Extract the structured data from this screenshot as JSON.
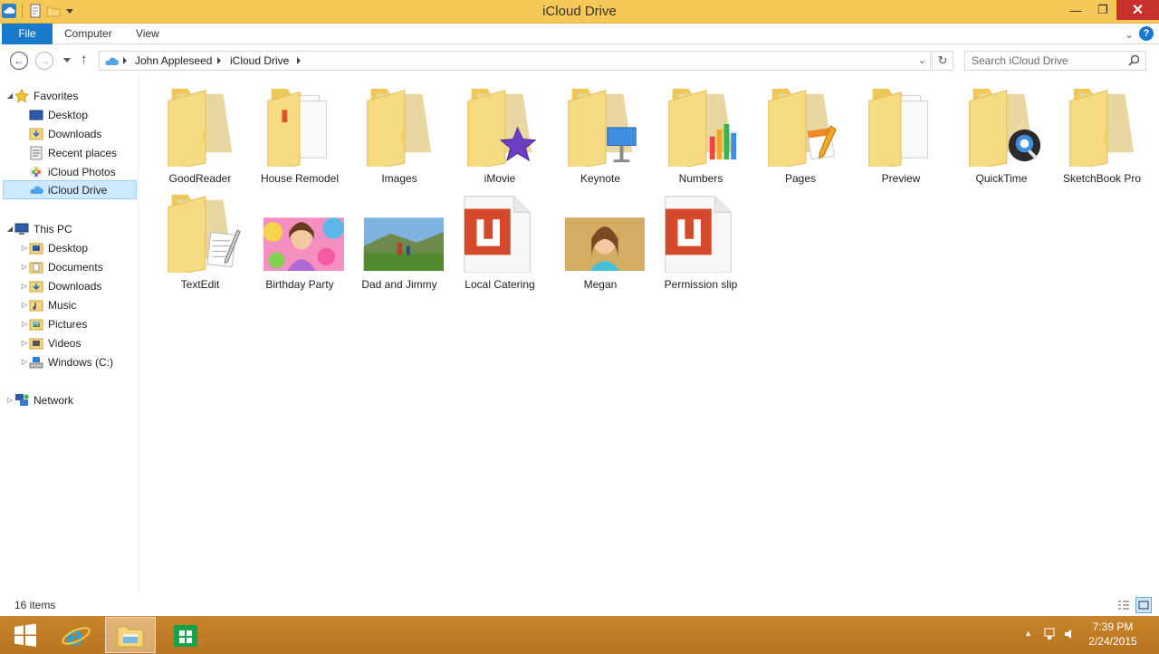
{
  "window": {
    "title": "iCloud Drive",
    "controls": {
      "minimize": "—",
      "maximize": "❐",
      "close": "✕"
    }
  },
  "ribbon": {
    "tabs": [
      "File",
      "Computer",
      "View"
    ],
    "help": "?"
  },
  "address": {
    "crumbs": [
      "John Appleseed",
      "iCloud Drive"
    ],
    "search_placeholder": "Search iCloud Drive"
  },
  "nav": {
    "favorites_label": "Favorites",
    "favorites": [
      "Desktop",
      "Downloads",
      "Recent places",
      "iCloud Photos",
      "iCloud Drive"
    ],
    "thispc_label": "This PC",
    "thispc": [
      "Desktop",
      "Documents",
      "Downloads",
      "Music",
      "Pictures",
      "Videos",
      "Windows (C:)"
    ],
    "network_label": "Network"
  },
  "content": {
    "items": [
      {
        "label": "GoodReader",
        "kind": "folder",
        "badge": "none"
      },
      {
        "label": "House Remodel",
        "kind": "folder-docs",
        "badge": "none"
      },
      {
        "label": "Images",
        "kind": "folder",
        "badge": "none"
      },
      {
        "label": "iMovie",
        "kind": "folder",
        "badge": "imovie-star-icon"
      },
      {
        "label": "Keynote",
        "kind": "folder",
        "badge": "keynote-icon"
      },
      {
        "label": "Numbers",
        "kind": "folder",
        "badge": "numbers-chart-icon"
      },
      {
        "label": "Pages",
        "kind": "folder",
        "badge": "pages-pen-icon"
      },
      {
        "label": "Preview",
        "kind": "folder-docs",
        "badge": "none"
      },
      {
        "label": "QuickTime",
        "kind": "folder",
        "badge": "quicktime-q-icon"
      },
      {
        "label": "SketchBook Pro",
        "kind": "folder",
        "badge": "none"
      },
      {
        "label": "TextEdit",
        "kind": "folder",
        "badge": "textedit-pencil-icon"
      },
      {
        "label": "Birthday Party",
        "kind": "photo",
        "badge": "none"
      },
      {
        "label": "Dad and Jimmy",
        "kind": "photo",
        "badge": "none"
      },
      {
        "label": "Local Catering",
        "kind": "pdf",
        "badge": "none"
      },
      {
        "label": "Megan",
        "kind": "photo",
        "badge": "none"
      },
      {
        "label": "Permission slip",
        "kind": "pdf",
        "badge": "none"
      }
    ]
  },
  "status": {
    "count": "16 items"
  },
  "taskbar": {
    "time": "7:39 PM",
    "date": "2/24/2015"
  },
  "colors": {
    "titlebar": "#f6c857",
    "accent": "#1979ca",
    "folder": "#f4d77a",
    "taskbar": "#c27d26",
    "pdf_red": "#d44a2a"
  }
}
